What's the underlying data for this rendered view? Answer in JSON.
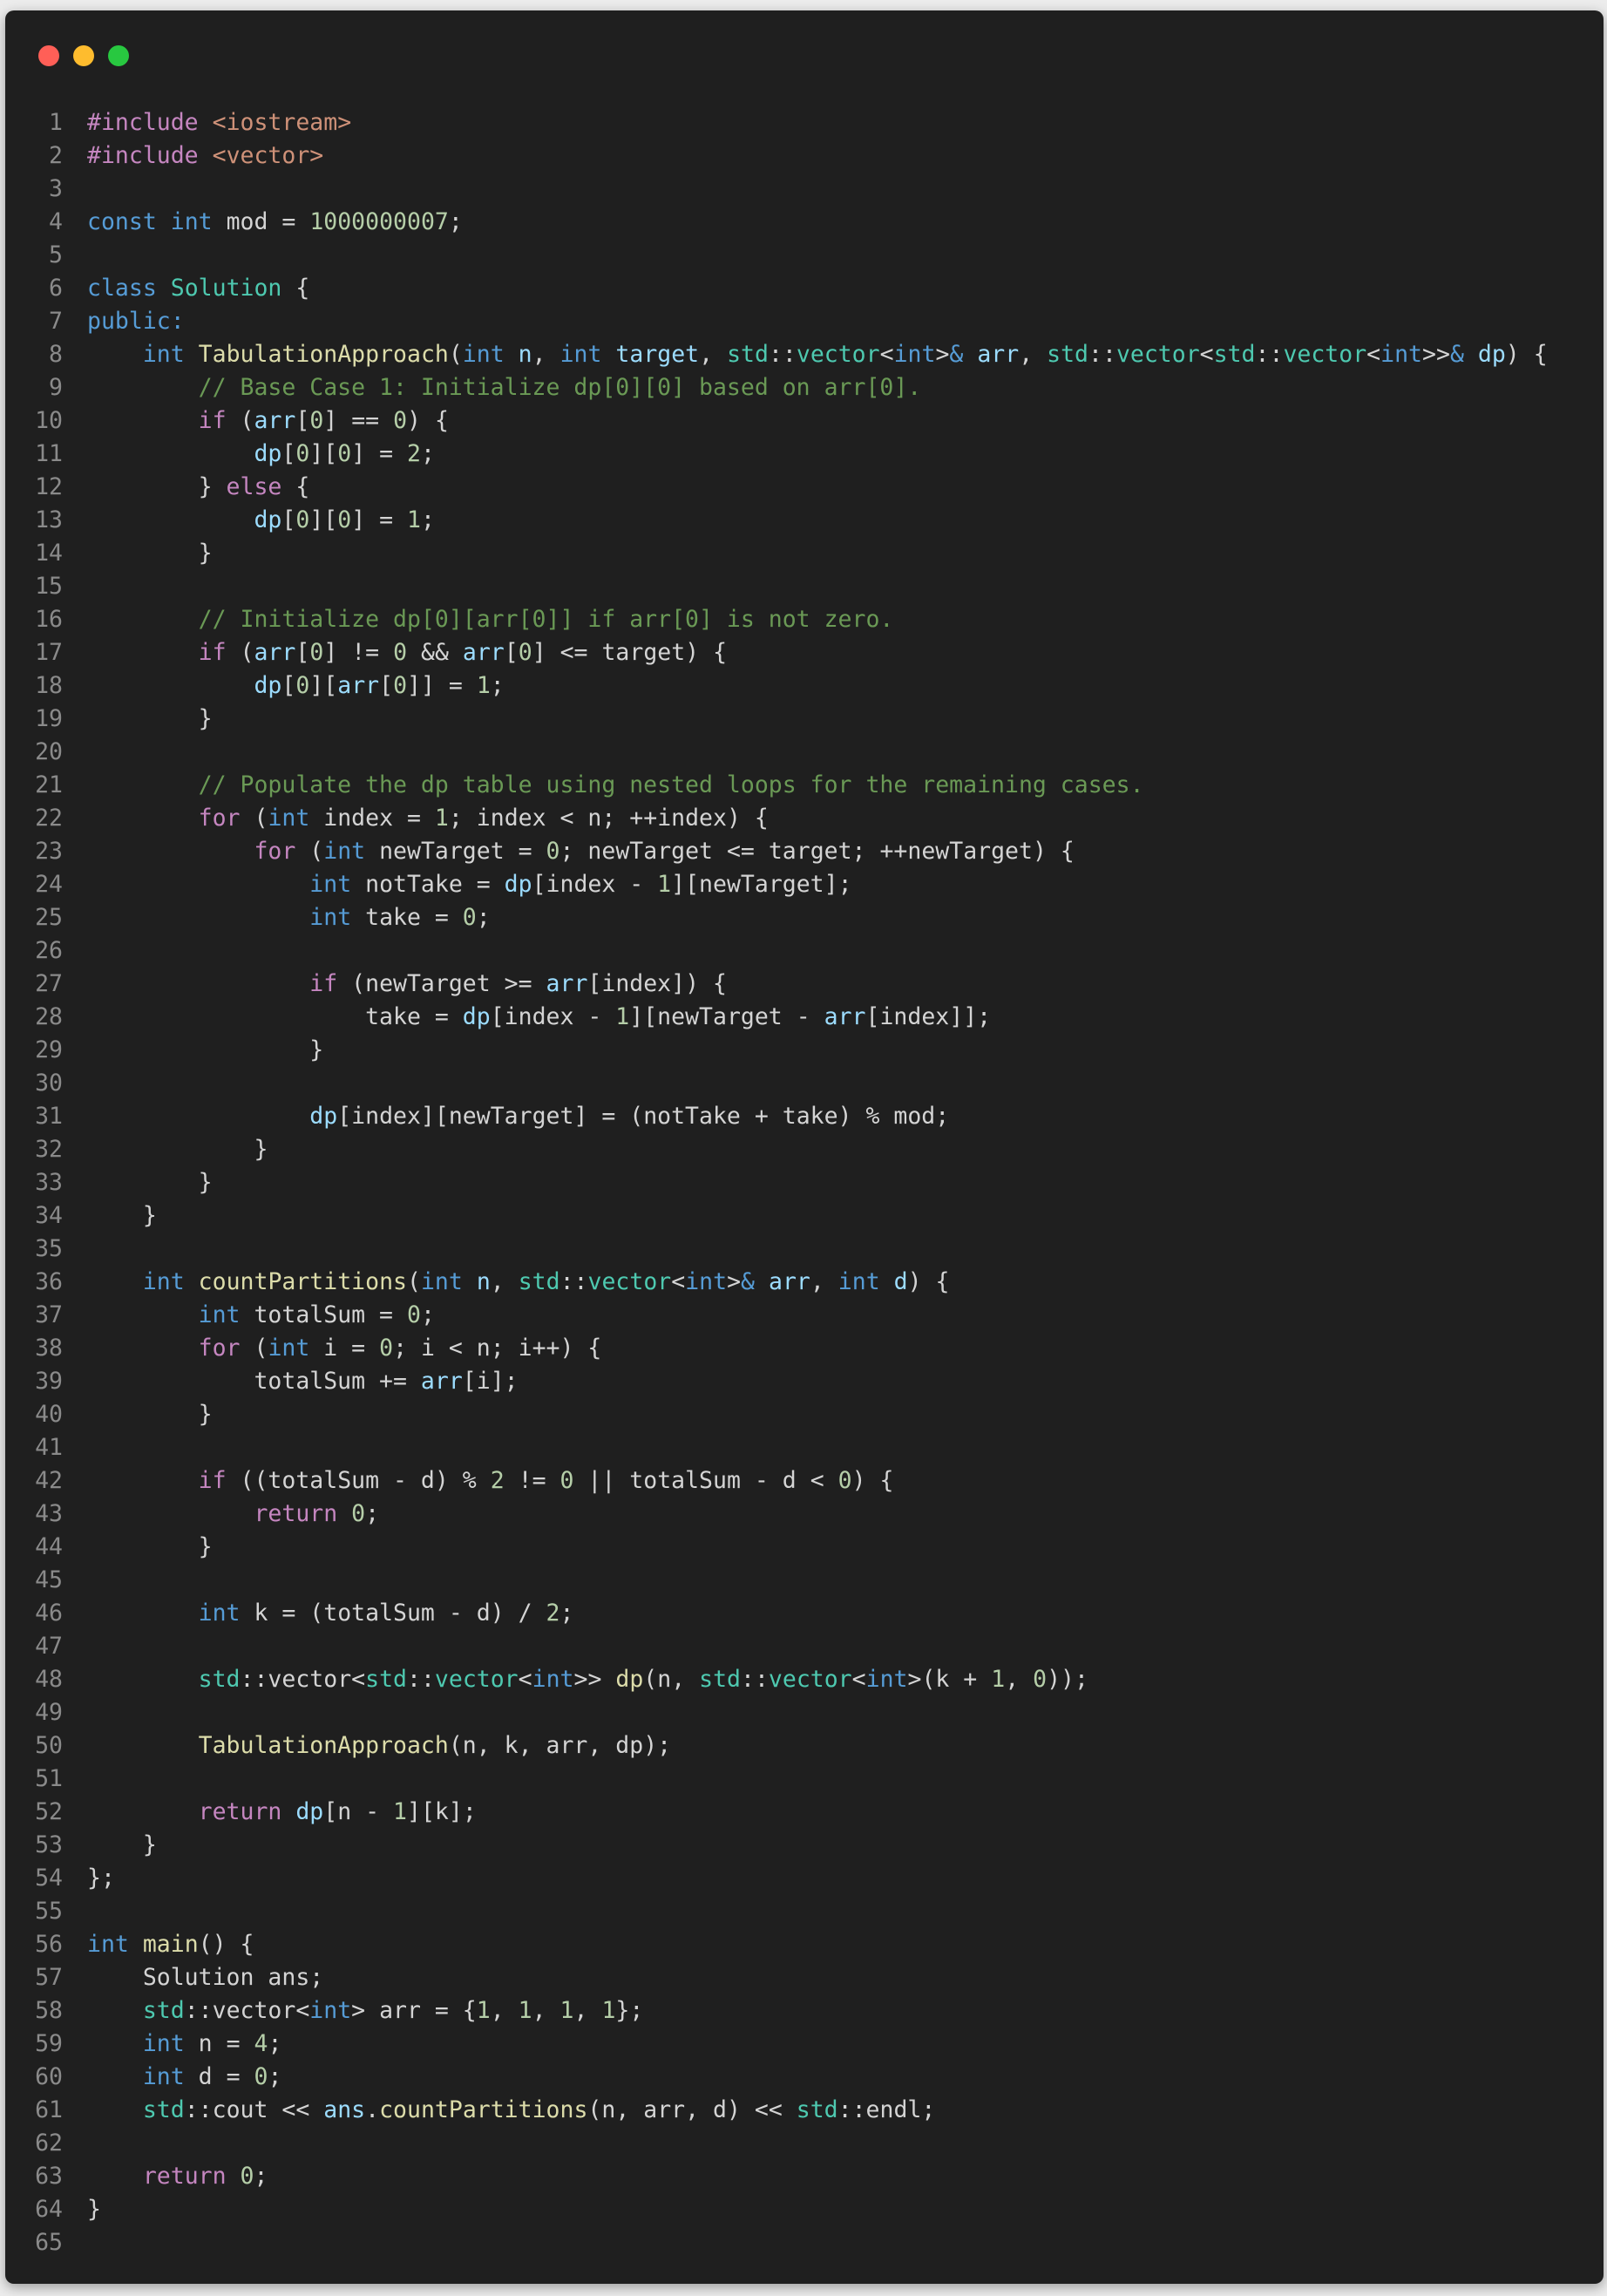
{
  "window": {
    "controls": [
      {
        "name": "close",
        "color": "#ff5f57"
      },
      {
        "name": "minimize",
        "color": "#febc2e"
      },
      {
        "name": "maximize",
        "color": "#28c840"
      }
    ]
  },
  "editor": {
    "lines": [
      [
        [
          "ctrl",
          "#include"
        ],
        [
          "plain",
          " "
        ],
        [
          "str",
          "<iostream>"
        ]
      ],
      [
        [
          "ctrl",
          "#include"
        ],
        [
          "plain",
          " "
        ],
        [
          "str",
          "<vector>"
        ]
      ],
      [],
      [
        [
          "kw",
          "const"
        ],
        [
          "plain",
          " "
        ],
        [
          "kw",
          "int"
        ],
        [
          "plain",
          " mod = "
        ],
        [
          "num",
          "1000000007"
        ],
        [
          "plain",
          ";"
        ]
      ],
      [],
      [
        [
          "kw",
          "class"
        ],
        [
          "plain",
          " "
        ],
        [
          "type",
          "Solution"
        ],
        [
          "plain",
          " {"
        ]
      ],
      [
        [
          "kw",
          "public:"
        ]
      ],
      [
        [
          "plain",
          "    "
        ],
        [
          "kw",
          "int"
        ],
        [
          "plain",
          " "
        ],
        [
          "fn",
          "TabulationApproach"
        ],
        [
          "plain",
          "("
        ],
        [
          "kw",
          "int"
        ],
        [
          "plain",
          " "
        ],
        [
          "var",
          "n"
        ],
        [
          "plain",
          ", "
        ],
        [
          "kw",
          "int"
        ],
        [
          "plain",
          " "
        ],
        [
          "var",
          "target"
        ],
        [
          "plain",
          ", "
        ],
        [
          "type",
          "std"
        ],
        [
          "plain",
          "::"
        ],
        [
          "type",
          "vector"
        ],
        [
          "plain",
          "<"
        ],
        [
          "kw",
          "int"
        ],
        [
          "plain",
          ">"
        ],
        [
          "kw",
          "&"
        ],
        [
          "plain",
          " "
        ],
        [
          "var",
          "arr"
        ],
        [
          "plain",
          ", "
        ],
        [
          "type",
          "std"
        ],
        [
          "plain",
          "::"
        ],
        [
          "type",
          "vector"
        ],
        [
          "plain",
          "<"
        ],
        [
          "type",
          "std"
        ],
        [
          "plain",
          "::"
        ],
        [
          "type",
          "vector"
        ],
        [
          "plain",
          "<"
        ],
        [
          "kw",
          "int"
        ],
        [
          "plain",
          ">>"
        ],
        [
          "kw",
          "&"
        ],
        [
          "plain",
          " "
        ],
        [
          "var",
          "dp"
        ],
        [
          "plain",
          ") {"
        ]
      ],
      [
        [
          "plain",
          "        "
        ],
        [
          "cm",
          "// Base Case 1: Initialize dp[0][0] based on arr[0]."
        ]
      ],
      [
        [
          "plain",
          "        "
        ],
        [
          "ctrl",
          "if"
        ],
        [
          "plain",
          " ("
        ],
        [
          "var",
          "arr"
        ],
        [
          "plain",
          "["
        ],
        [
          "num",
          "0"
        ],
        [
          "plain",
          "] == "
        ],
        [
          "num",
          "0"
        ],
        [
          "plain",
          ") {"
        ]
      ],
      [
        [
          "plain",
          "            "
        ],
        [
          "var",
          "dp"
        ],
        [
          "plain",
          "["
        ],
        [
          "num",
          "0"
        ],
        [
          "plain",
          "]["
        ],
        [
          "num",
          "0"
        ],
        [
          "plain",
          "] = "
        ],
        [
          "num",
          "2"
        ],
        [
          "plain",
          ";"
        ]
      ],
      [
        [
          "plain",
          "        } "
        ],
        [
          "ctrl",
          "else"
        ],
        [
          "plain",
          " {"
        ]
      ],
      [
        [
          "plain",
          "            "
        ],
        [
          "var",
          "dp"
        ],
        [
          "plain",
          "["
        ],
        [
          "num",
          "0"
        ],
        [
          "plain",
          "]["
        ],
        [
          "num",
          "0"
        ],
        [
          "plain",
          "] = "
        ],
        [
          "num",
          "1"
        ],
        [
          "plain",
          ";"
        ]
      ],
      [
        [
          "plain",
          "        }"
        ]
      ],
      [],
      [
        [
          "plain",
          "        "
        ],
        [
          "cm",
          "// Initialize dp[0][arr[0]] if arr[0] is not zero."
        ]
      ],
      [
        [
          "plain",
          "        "
        ],
        [
          "ctrl",
          "if"
        ],
        [
          "plain",
          " ("
        ],
        [
          "var",
          "arr"
        ],
        [
          "plain",
          "["
        ],
        [
          "num",
          "0"
        ],
        [
          "plain",
          "] != "
        ],
        [
          "num",
          "0"
        ],
        [
          "plain",
          " && "
        ],
        [
          "var",
          "arr"
        ],
        [
          "plain",
          "["
        ],
        [
          "num",
          "0"
        ],
        [
          "plain",
          "] <= target) {"
        ]
      ],
      [
        [
          "plain",
          "            "
        ],
        [
          "var",
          "dp"
        ],
        [
          "plain",
          "["
        ],
        [
          "num",
          "0"
        ],
        [
          "plain",
          "]["
        ],
        [
          "var",
          "arr"
        ],
        [
          "plain",
          "["
        ],
        [
          "num",
          "0"
        ],
        [
          "plain",
          "]] = "
        ],
        [
          "num",
          "1"
        ],
        [
          "plain",
          ";"
        ]
      ],
      [
        [
          "plain",
          "        }"
        ]
      ],
      [],
      [
        [
          "plain",
          "        "
        ],
        [
          "cm",
          "// Populate the dp table using nested loops for the remaining cases."
        ]
      ],
      [
        [
          "plain",
          "        "
        ],
        [
          "ctrl",
          "for"
        ],
        [
          "plain",
          " ("
        ],
        [
          "kw",
          "int"
        ],
        [
          "plain",
          " index = "
        ],
        [
          "num",
          "1"
        ],
        [
          "plain",
          "; index < n; ++index) {"
        ]
      ],
      [
        [
          "plain",
          "            "
        ],
        [
          "ctrl",
          "for"
        ],
        [
          "plain",
          " ("
        ],
        [
          "kw",
          "int"
        ],
        [
          "plain",
          " newTarget = "
        ],
        [
          "num",
          "0"
        ],
        [
          "plain",
          "; newTarget <= target; ++newTarget) {"
        ]
      ],
      [
        [
          "plain",
          "                "
        ],
        [
          "kw",
          "int"
        ],
        [
          "plain",
          " notTake = "
        ],
        [
          "var",
          "dp"
        ],
        [
          "plain",
          "[index - "
        ],
        [
          "num",
          "1"
        ],
        [
          "plain",
          "][newTarget];"
        ]
      ],
      [
        [
          "plain",
          "                "
        ],
        [
          "kw",
          "int"
        ],
        [
          "plain",
          " take = "
        ],
        [
          "num",
          "0"
        ],
        [
          "plain",
          ";"
        ]
      ],
      [],
      [
        [
          "plain",
          "                "
        ],
        [
          "ctrl",
          "if"
        ],
        [
          "plain",
          " (newTarget >= "
        ],
        [
          "var",
          "arr"
        ],
        [
          "plain",
          "[index]) {"
        ]
      ],
      [
        [
          "plain",
          "                    take = "
        ],
        [
          "var",
          "dp"
        ],
        [
          "plain",
          "[index - "
        ],
        [
          "num",
          "1"
        ],
        [
          "plain",
          "][newTarget - "
        ],
        [
          "var",
          "arr"
        ],
        [
          "plain",
          "[index]];"
        ]
      ],
      [
        [
          "plain",
          "                }"
        ]
      ],
      [],
      [
        [
          "plain",
          "                "
        ],
        [
          "var",
          "dp"
        ],
        [
          "plain",
          "[index][newTarget] = (notTake + take) % mod;"
        ]
      ],
      [
        [
          "plain",
          "            }"
        ]
      ],
      [
        [
          "plain",
          "        }"
        ]
      ],
      [
        [
          "plain",
          "    }"
        ]
      ],
      [],
      [
        [
          "plain",
          "    "
        ],
        [
          "kw",
          "int"
        ],
        [
          "plain",
          " "
        ],
        [
          "fn",
          "countPartitions"
        ],
        [
          "plain",
          "("
        ],
        [
          "kw",
          "int"
        ],
        [
          "plain",
          " "
        ],
        [
          "var",
          "n"
        ],
        [
          "plain",
          ", "
        ],
        [
          "type",
          "std"
        ],
        [
          "plain",
          "::"
        ],
        [
          "type",
          "vector"
        ],
        [
          "plain",
          "<"
        ],
        [
          "kw",
          "int"
        ],
        [
          "plain",
          ">"
        ],
        [
          "kw",
          "&"
        ],
        [
          "plain",
          " "
        ],
        [
          "var",
          "arr"
        ],
        [
          "plain",
          ", "
        ],
        [
          "kw",
          "int"
        ],
        [
          "plain",
          " "
        ],
        [
          "var",
          "d"
        ],
        [
          "plain",
          ") {"
        ]
      ],
      [
        [
          "plain",
          "        "
        ],
        [
          "kw",
          "int"
        ],
        [
          "plain",
          " totalSum = "
        ],
        [
          "num",
          "0"
        ],
        [
          "plain",
          ";"
        ]
      ],
      [
        [
          "plain",
          "        "
        ],
        [
          "ctrl",
          "for"
        ],
        [
          "plain",
          " ("
        ],
        [
          "kw",
          "int"
        ],
        [
          "plain",
          " i = "
        ],
        [
          "num",
          "0"
        ],
        [
          "plain",
          "; i < n; i++) {"
        ]
      ],
      [
        [
          "plain",
          "            totalSum += "
        ],
        [
          "var",
          "arr"
        ],
        [
          "plain",
          "[i];"
        ]
      ],
      [
        [
          "plain",
          "        }"
        ]
      ],
      [],
      [
        [
          "plain",
          "        "
        ],
        [
          "ctrl",
          "if"
        ],
        [
          "plain",
          " ((totalSum - d) % "
        ],
        [
          "num",
          "2"
        ],
        [
          "plain",
          " != "
        ],
        [
          "num",
          "0"
        ],
        [
          "plain",
          " || totalSum - d < "
        ],
        [
          "num",
          "0"
        ],
        [
          "plain",
          ") {"
        ]
      ],
      [
        [
          "plain",
          "            "
        ],
        [
          "ctrl",
          "return"
        ],
        [
          "plain",
          " "
        ],
        [
          "num",
          "0"
        ],
        [
          "plain",
          ";"
        ]
      ],
      [
        [
          "plain",
          "        }"
        ]
      ],
      [],
      [
        [
          "plain",
          "        "
        ],
        [
          "kw",
          "int"
        ],
        [
          "plain",
          " k = (totalSum - d) / "
        ],
        [
          "num",
          "2"
        ],
        [
          "plain",
          ";"
        ]
      ],
      [],
      [
        [
          "plain",
          "        "
        ],
        [
          "type",
          "std"
        ],
        [
          "plain",
          "::vector<"
        ],
        [
          "type",
          "std"
        ],
        [
          "plain",
          "::"
        ],
        [
          "type",
          "vector"
        ],
        [
          "plain",
          "<"
        ],
        [
          "kw",
          "int"
        ],
        [
          "plain",
          ">> "
        ],
        [
          "fn",
          "dp"
        ],
        [
          "plain",
          "(n, "
        ],
        [
          "type",
          "std"
        ],
        [
          "plain",
          "::"
        ],
        [
          "type",
          "vector"
        ],
        [
          "plain",
          "<"
        ],
        [
          "kw",
          "int"
        ],
        [
          "plain",
          ">(k + "
        ],
        [
          "num",
          "1"
        ],
        [
          "plain",
          ", "
        ],
        [
          "num",
          "0"
        ],
        [
          "plain",
          "));"
        ]
      ],
      [],
      [
        [
          "plain",
          "        "
        ],
        [
          "fn",
          "TabulationApproach"
        ],
        [
          "plain",
          "(n, k, arr, dp);"
        ]
      ],
      [],
      [
        [
          "plain",
          "        "
        ],
        [
          "ctrl",
          "return"
        ],
        [
          "plain",
          " "
        ],
        [
          "var",
          "dp"
        ],
        [
          "plain",
          "[n - "
        ],
        [
          "num",
          "1"
        ],
        [
          "plain",
          "][k];"
        ]
      ],
      [
        [
          "plain",
          "    }"
        ]
      ],
      [
        [
          "plain",
          "};"
        ]
      ],
      [],
      [
        [
          "kw",
          "int"
        ],
        [
          "plain",
          " "
        ],
        [
          "fn",
          "main"
        ],
        [
          "plain",
          "() {"
        ]
      ],
      [
        [
          "plain",
          "    Solution ans;"
        ]
      ],
      [
        [
          "plain",
          "    "
        ],
        [
          "type",
          "std"
        ],
        [
          "plain",
          "::vector<"
        ],
        [
          "kw",
          "int"
        ],
        [
          "plain",
          "> arr = {"
        ],
        [
          "num",
          "1"
        ],
        [
          "plain",
          ", "
        ],
        [
          "num",
          "1"
        ],
        [
          "plain",
          ", "
        ],
        [
          "num",
          "1"
        ],
        [
          "plain",
          ", "
        ],
        [
          "num",
          "1"
        ],
        [
          "plain",
          "};"
        ]
      ],
      [
        [
          "plain",
          "    "
        ],
        [
          "kw",
          "int"
        ],
        [
          "plain",
          " n = "
        ],
        [
          "num",
          "4"
        ],
        [
          "plain",
          ";"
        ]
      ],
      [
        [
          "plain",
          "    "
        ],
        [
          "kw",
          "int"
        ],
        [
          "plain",
          " d = "
        ],
        [
          "num",
          "0"
        ],
        [
          "plain",
          ";"
        ]
      ],
      [
        [
          "plain",
          "    "
        ],
        [
          "type",
          "std"
        ],
        [
          "plain",
          "::cout << "
        ],
        [
          "var",
          "ans"
        ],
        [
          "plain",
          "."
        ],
        [
          "fn",
          "countPartitions"
        ],
        [
          "plain",
          "(n, arr, d) << "
        ],
        [
          "type",
          "std"
        ],
        [
          "plain",
          "::endl;"
        ]
      ],
      [],
      [
        [
          "plain",
          "    "
        ],
        [
          "ctrl",
          "return"
        ],
        [
          "plain",
          " "
        ],
        [
          "num",
          "0"
        ],
        [
          "plain",
          ";"
        ]
      ],
      [
        [
          "plain",
          "}"
        ]
      ],
      []
    ]
  }
}
